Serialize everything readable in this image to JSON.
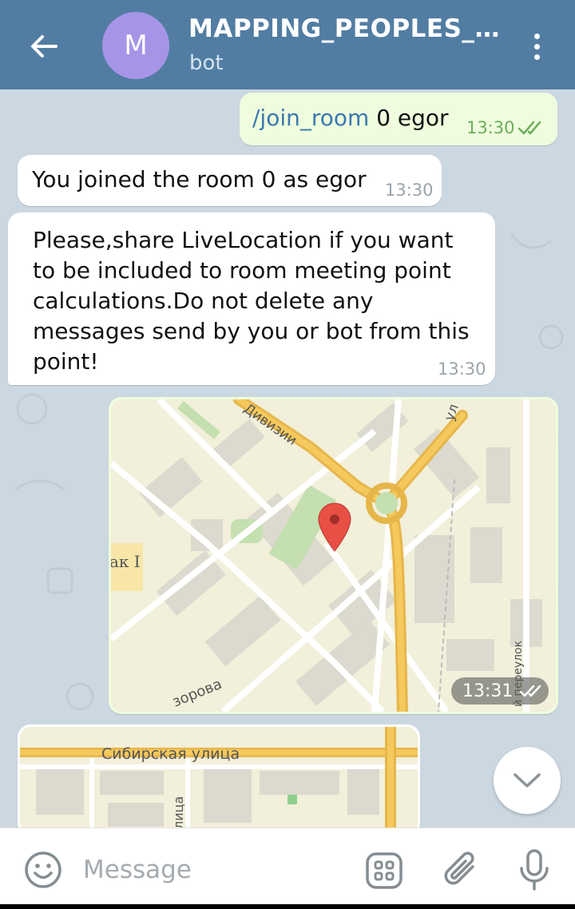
{
  "header": {
    "title": "MAPPING_PEOPLES_...",
    "subtitle": "bot",
    "avatar_letter": "M",
    "avatar_color": "#a695e7",
    "bar_color": "#527da3"
  },
  "messages": [
    {
      "direction": "out",
      "command": "/join_room",
      "text": " 0 egor",
      "time": "13:30",
      "status": "read-double-check"
    },
    {
      "direction": "in",
      "text": "You joined the room 0 as egor",
      "time": "13:30"
    },
    {
      "direction": "in",
      "text": "Please,share LiveLocation if you want to be included to room meeting point calculations.Do not delete any messages send by you or bot from this point!",
      "time": "13:30"
    },
    {
      "direction": "out",
      "type": "location",
      "time": "13:31",
      "status": "read-double-check",
      "map_labels": [
        "Дивизии",
        "ул",
        "ак I",
        "й переулок",
        "зорова"
      ]
    },
    {
      "direction": "in",
      "type": "location",
      "map_labels": [
        "Сибирская улица",
        "лица"
      ]
    }
  ],
  "input": {
    "placeholder": "Message",
    "value": ""
  },
  "icons": {
    "back": "arrow-left-icon",
    "menu": "more-vertical-icon",
    "emoji": "smile-icon",
    "bot_commands": "grid-icon",
    "attach": "paperclip-icon",
    "mic": "microphone-icon",
    "scroll": "chevron-down-icon",
    "pin": "map-pin-icon"
  }
}
